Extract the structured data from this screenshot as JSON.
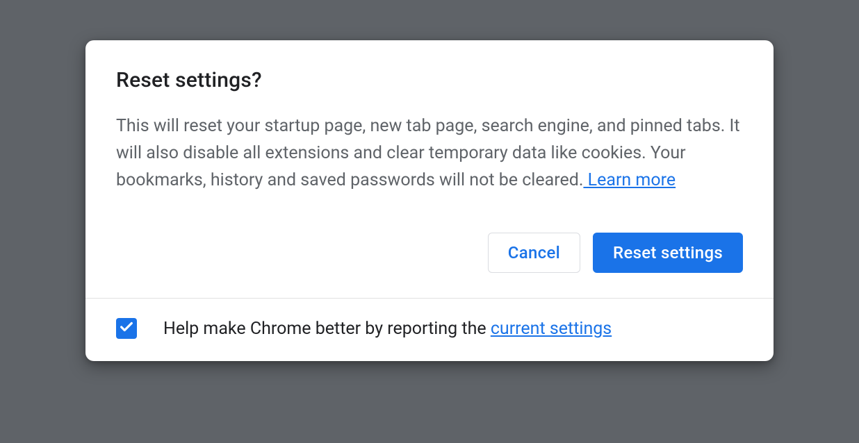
{
  "dialog": {
    "title": "Reset settings?",
    "body_text": "This will reset your startup page, new tab page, search engine, and pinned tabs. It will also disable all extensions and clear temporary data like cookies. Your bookmarks, history and saved passwords will not be cleared.",
    "learn_more_label": " Learn more",
    "actions": {
      "cancel_label": "Cancel",
      "confirm_label": "Reset settings"
    },
    "footer": {
      "checkbox_checked": true,
      "help_text_prefix": "Help make Chrome better by reporting the ",
      "help_link_label": "current settings"
    }
  }
}
